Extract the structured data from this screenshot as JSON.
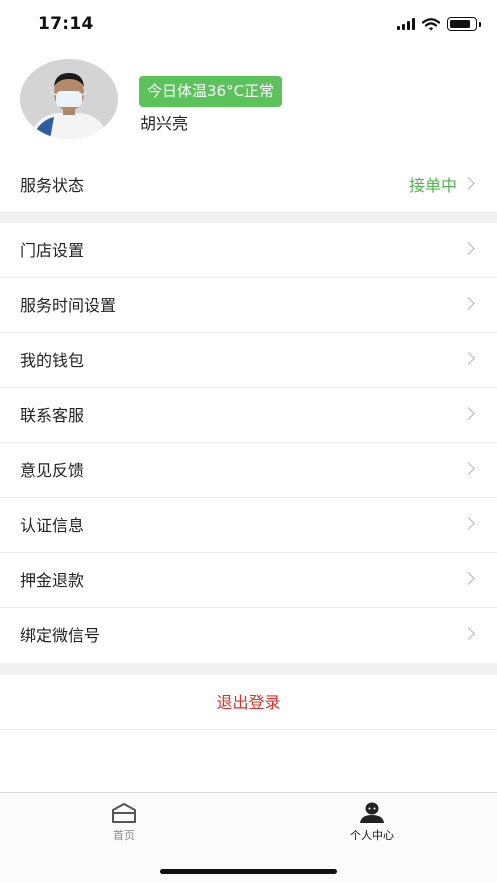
{
  "status_bar": {
    "time": "17:14",
    "icons": [
      "signal-icon",
      "wifi-icon",
      "battery-icon"
    ]
  },
  "profile": {
    "temperature_badge": "今日体温36°C正常",
    "name": "胡兴亮",
    "avatar": "avatar-photo"
  },
  "service_status": {
    "label": "服务状态",
    "value": "接单中"
  },
  "menu": [
    {
      "label": "门店设置"
    },
    {
      "label": "服务时间设置"
    },
    {
      "label": "我的钱包"
    },
    {
      "label": "联系客服"
    },
    {
      "label": "意见反馈"
    },
    {
      "label": "认证信息"
    },
    {
      "label": "押金退款"
    },
    {
      "label": "绑定微信号"
    }
  ],
  "logout": {
    "label": "退出登录"
  },
  "tabbar": {
    "items": [
      {
        "label": "首页",
        "icon": "home-icon",
        "active": false
      },
      {
        "label": "个人中心",
        "icon": "profile-icon",
        "active": true
      }
    ]
  },
  "colors": {
    "accent_green": "#5cc25c",
    "status_green": "#4cb94c",
    "logout_red": "#d9322e",
    "divider": "#f1f1f1"
  }
}
